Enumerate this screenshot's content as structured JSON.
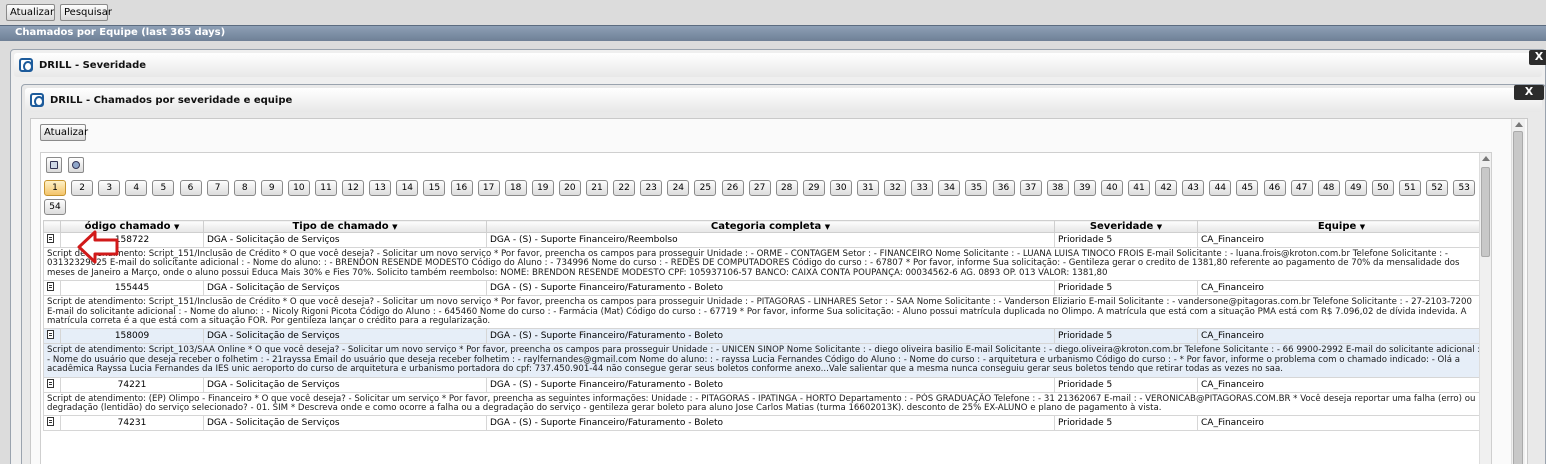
{
  "toolbar": {
    "atualizar_label": "Atualizar",
    "pesquisar_label": "Pesquisar"
  },
  "main_panel": {
    "title": "Chamados por Equipe (last 365 days)"
  },
  "drill1": {
    "title": "DRILL - Severidade",
    "close_label": "X"
  },
  "drill2": {
    "title": "DRILL - Chamados por severidade e equipe",
    "close_label": "X",
    "atualizar_label": "Atualizar"
  },
  "pagination": {
    "current": 1,
    "pages": [
      "1",
      "2",
      "3",
      "4",
      "5",
      "6",
      "7",
      "8",
      "9",
      "10",
      "11",
      "12",
      "13",
      "14",
      "15",
      "16",
      "17",
      "18",
      "19",
      "20",
      "21",
      "22",
      "23",
      "24",
      "25",
      "26",
      "27",
      "28",
      "29",
      "30",
      "31",
      "32",
      "33",
      "34",
      "35",
      "36",
      "37",
      "38",
      "39",
      "40",
      "41",
      "42",
      "43",
      "44",
      "45",
      "46",
      "47",
      "48",
      "49",
      "50",
      "51",
      "52",
      "53",
      "54"
    ]
  },
  "table": {
    "columns": [
      "ódigo chamado",
      "Tipo de chamado",
      "Categoria completa",
      "Severidade",
      "Equipe"
    ],
    "rows": [
      {
        "codigo": "158722",
        "tipo": "DGA - Solicitação de Serviços",
        "categoria": "DGA - (S) - Suporte Financeiro/Reembolso",
        "severidade": "Prioridade 5",
        "equipe": "CA_Financeiro",
        "descricao": "Script de atendimento: Script_151/Inclusão de Crédito * O que você deseja? - Solicitar um novo serviço * Por favor, preencha os campos para prosseguir Unidade : - ORME - CONTAGEM Setor : - FINANCEIRO Nome Solicitante : - LUANA LUISA TINOCO FROIS E-mail Solicitante : - luana.frois@kroton.com.br Telefone Solicitante : - 03132329025 E-mail do solicitante adicional : - Nome do aluno: : - BRENDON RESENDE MODESTO Código do Aluno : - 734996 Nome do curso : - REDES DE COMPUTADORES Código do curso : - 67807 * Por favor, informe Sua solicitação: - Gentileza gerar o credito de 1381,80 referente ao pagamento de 70% da mensalidade dos meses de Janeiro a Março, onde o aluno possui Educa Mais 30% e Fies 70%. Solicito também reembolso: NOME: BRENDON RESENDE MODESTO CPF: 105937106-57 BANCO: CAIXA CONTA POUPANÇA: 00034562-6 AG. 0893 OP. 013 VALOR: 1381,80"
      },
      {
        "codigo": "155445",
        "tipo": "DGA - Solicitação de Serviços",
        "categoria": "DGA - (S) - Suporte Financeiro/Faturamento - Boleto",
        "severidade": "Prioridade 5",
        "equipe": "CA_Financeiro",
        "descricao": "Script de atendimento: Script_151/Inclusão de Crédito * O que você deseja? - Solicitar um novo serviço * Por favor, preencha os campos para prosseguir Unidade : - PITAGORAS - LINHARES Setor : - SAA Nome Solicitante : - Vanderson Eliziario E-mail Solicitante : - vandersone@pitagoras.com.br Telefone Solicitante : - 27-2103-7200 E-mail do solicitante adicional : - Nome do aluno: : - Nicoly Rigoni Picota Código do Aluno : - 645460 Nome do curso : - Farmácia (Mat) Código do curso : - 67719 * Por favor, informe Sua solicitação: - Aluno possui matrícula duplicada no Olimpo. A matrícula que está com a situação PMA está com R$ 7.096,02 de dívida indevida. A matrícula correta é a que está com a situação FOR. Por gentileza lançar o crédito para a regularização."
      },
      {
        "codigo": "158009",
        "tipo": "DGA - Solicitação de Serviços",
        "categoria": "DGA - (S) - Suporte Financeiro/Faturamento - Boleto",
        "severidade": "Prioridade 5",
        "equipe": "CA_Financeiro",
        "descricao": "Script de atendimento: Script_103/SAA Online * O que você deseja? - Solicitar um novo serviço * Por favor, preencha os campos para prosseguir Unidade : - UNICEN SINOP Nome Solicitante : - diego oliveira basilio E-mail Solicitante : - diego.oliveira@kroton.com.br Telefone Solicitante : - 66 9900-2992 E-mail do solicitante adicional : - Nome do usuário que deseja receber o folhetim : - 21rayssa Email do usuário que deseja receber folhetim : - raylfernandes@gmail.com Nome do aluno: : - rayssa Lucia Fernandes Código do Aluno : - Nome do curso : - arquitetura e urbanismo Código do curso : - * Por favor, informe o problema com o chamado indicado: - Olá a acadêmica Rayssa Lucia Fernandes da IES unic aeroporto do curso de arquitetura e urbanismo portadora do cpf: 737.450.901-44 não consegue gerar seus boletos conforme anexo...Vale salientar que a mesma nunca conseguiu gerar seus boletos tendo que retirar todas as vezes no saa."
      },
      {
        "codigo": "74221",
        "tipo": "DGA - Solicitação de Serviços",
        "categoria": "DGA - (S) - Suporte Financeiro/Faturamento - Boleto",
        "severidade": "Prioridade 5",
        "equipe": "CA_Financeiro",
        "descricao": "Script de atendimento: (EP) Olimpo - Financeiro * O que você deseja? - Solicitar um serviço * Por favor, preencha as seguintes informações: Unidade : - PITAGORAS - IPATINGA - HORTO Departamento : - PÓS GRADUAÇÃO Telefone : - 31 21362067 E-mail : - VERONICAB@PITAGORAS.COM.BR * Você deseja reportar uma falha (erro) ou degradação (lentidão) do serviço selecionado? - 01. SIM * Descreva onde e como ocorre a falha ou a degradação do serviço - gentileza gerar boleto para aluno Jose Carlos Matias (turma 16602013K). desconto de 25% EX-ALUNO e plano de pagamento à vista."
      },
      {
        "codigo": "74231",
        "tipo": "DGA - Solicitação de Serviços",
        "categoria": "DGA - (S) - Suporte Financeiro/Faturamento - Boleto",
        "severidade": "Prioridade 5",
        "equipe": "CA_Financeiro",
        "descricao": ""
      }
    ]
  },
  "icons": {
    "row": "document-icon",
    "export": "export-icon",
    "globe": "globe-icon",
    "annotation": "red-arrow-left-icon"
  },
  "colors": {
    "accent": "#1d5b9b",
    "alt_row": "#e6eef8",
    "arrow": "#d11a1a"
  }
}
